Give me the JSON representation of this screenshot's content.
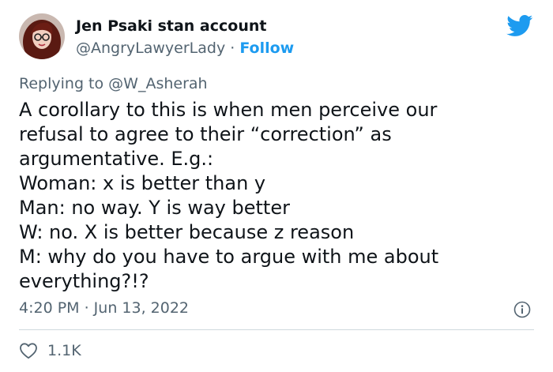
{
  "author": {
    "display_name": "Jen Psaki stan account",
    "handle": "@AngryLawyerLady",
    "separator": "·",
    "follow_label": "Follow"
  },
  "reply": {
    "prefix": "Replying to",
    "mention": "@W_Asherah"
  },
  "tweet": {
    "lines": [
      "A corollary to this is when men perceive our",
      "refusal to agree to their “correction” as",
      "argumentative. E.g.:",
      "Woman: x is better than y",
      "Man: no way. Y is way better",
      "W: no. X is better because z reason",
      "M: why do you have to argue with me about",
      "everything?!?"
    ]
  },
  "meta": {
    "timestamp": "4:20 PM · Jun 13, 2022"
  },
  "engagement": {
    "likes": "1.1K"
  },
  "icons": {
    "brand": "twitter-bird-icon",
    "info": "info-icon",
    "like": "heart-icon"
  },
  "colors": {
    "accent": "#1d9bf0",
    "text": "#0f1419",
    "muted": "#536471",
    "divider": "#cfd9de"
  }
}
